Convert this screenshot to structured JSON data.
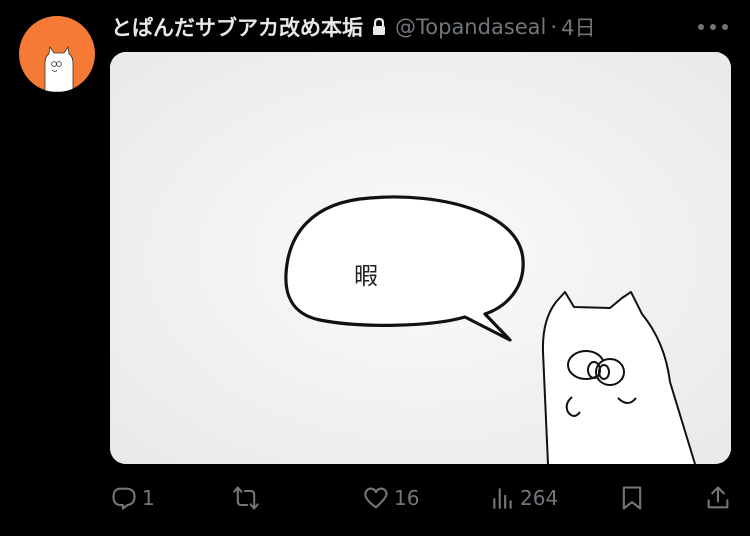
{
  "author": {
    "display_name": "とぱんだサブアカ改め本垢",
    "handle": "@Topandaseal",
    "separator": "·",
    "time": "4日",
    "avatar_color": "#f47a35",
    "protected_icon": "lock-icon"
  },
  "media": {
    "bubble_text": "暇"
  },
  "actions": {
    "reply_count": "1",
    "retweet_count": "",
    "like_count": "16",
    "views_count": "264"
  },
  "icons": {
    "more": "more-icon",
    "reply": "reply-icon",
    "retweet": "retweet-icon",
    "like": "heart-icon",
    "views": "analytics-icon",
    "bookmark": "bookmark-icon",
    "share": "share-icon"
  },
  "colors": {
    "background": "#000000",
    "text_primary": "#e7e9ea",
    "text_secondary": "#71767b"
  }
}
